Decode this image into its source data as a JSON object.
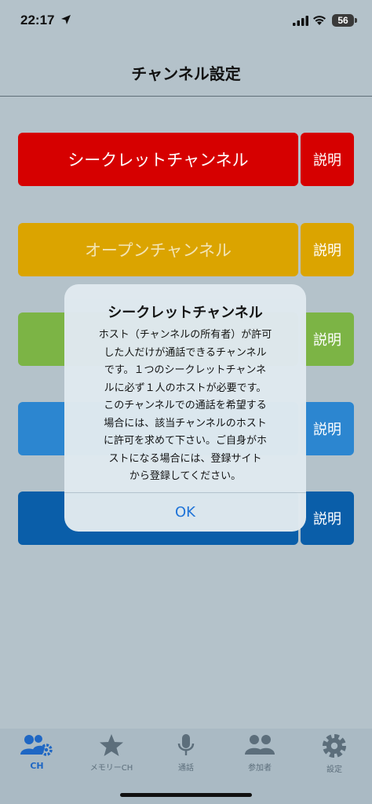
{
  "status_bar": {
    "time": "22:17",
    "battery": "56"
  },
  "header": {
    "title": "チャンネル設定"
  },
  "channels": [
    {
      "label": "シークレットチャンネル",
      "explain": "説明",
      "color": "#d60000",
      "text_color": "#ffffff"
    },
    {
      "label": "オープンチャンネル",
      "explain": "説明",
      "color": "#dba400",
      "text_color": "#f3e4b3"
    },
    {
      "label": "",
      "explain": "説明",
      "color": "#7cb445",
      "text_color": "#ffffff"
    },
    {
      "label": "",
      "explain": "説明",
      "color": "#2c86d0",
      "text_color": "#ffffff"
    },
    {
      "label": "",
      "explain": "説明",
      "color": "#0a5ea9",
      "text_color": "#ffffff"
    }
  ],
  "dialog": {
    "title": "シークレットチャンネル",
    "message_lines": [
      "ホスト（チャンネルの所有者）が許可",
      "した人だけが通話できるチャンネル",
      "です。１つのシークレットチャンネ",
      "ルに必ず１人のホストが必要です。",
      "このチャンネルでの通話を希望する",
      "場合には、該当チャンネルのホスト",
      "に許可を求めて下さい。ご自身がホ",
      "ストになる場合には、登録サイト",
      "から登録してください。"
    ],
    "ok_label": "OK"
  },
  "tabs": [
    {
      "label": "CH",
      "icon": "group-gear-icon",
      "active": true
    },
    {
      "label": "メモリーCH",
      "icon": "star-icon",
      "active": false
    },
    {
      "label": "通話",
      "icon": "microphone-icon",
      "active": false
    },
    {
      "label": "参加者",
      "icon": "people-icon",
      "active": false
    },
    {
      "label": "設定",
      "icon": "gear-icon",
      "active": false
    }
  ],
  "colors": {
    "accent": "#1f67c4",
    "inactive_tab": "#5c6e7b",
    "background": "#b4c2ca"
  }
}
